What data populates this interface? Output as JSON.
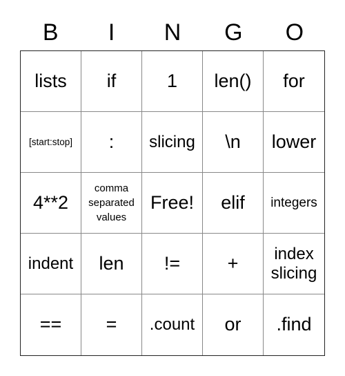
{
  "header": [
    "B",
    "I",
    "N",
    "G",
    "O"
  ],
  "cells": [
    [
      "lists",
      "if",
      "1",
      "len()",
      "for"
    ],
    [
      "[start:stop]",
      ":",
      "slicing",
      "\\n",
      "lower"
    ],
    [
      "4**2",
      "comma separated values",
      "Free!",
      "elif",
      "integers"
    ],
    [
      "indent",
      "len",
      "!=",
      "+",
      "index slicing"
    ],
    [
      "==",
      "=",
      ".count",
      "or",
      ".find"
    ]
  ]
}
